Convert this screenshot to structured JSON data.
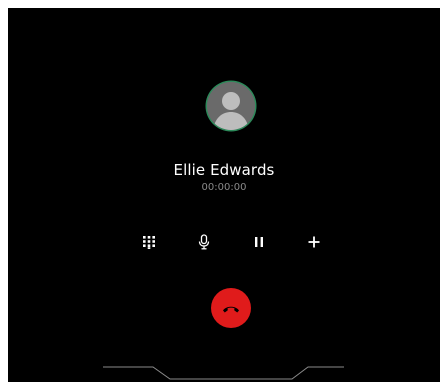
{
  "call": {
    "caller_name": "Ellie Edwards",
    "timer": "00:00:00"
  },
  "controls": [
    {
      "icon": "dialpad-icon"
    },
    {
      "icon": "microphone-icon"
    },
    {
      "icon": "pause-icon"
    },
    {
      "icon": "add-icon"
    }
  ],
  "end_call": {
    "icon": "hang-up-icon"
  },
  "colors": {
    "background": "#000000",
    "end_call": "#e01b1b",
    "avatar_ring": "#2c8a5a",
    "timer_text": "#8a8a8a"
  }
}
